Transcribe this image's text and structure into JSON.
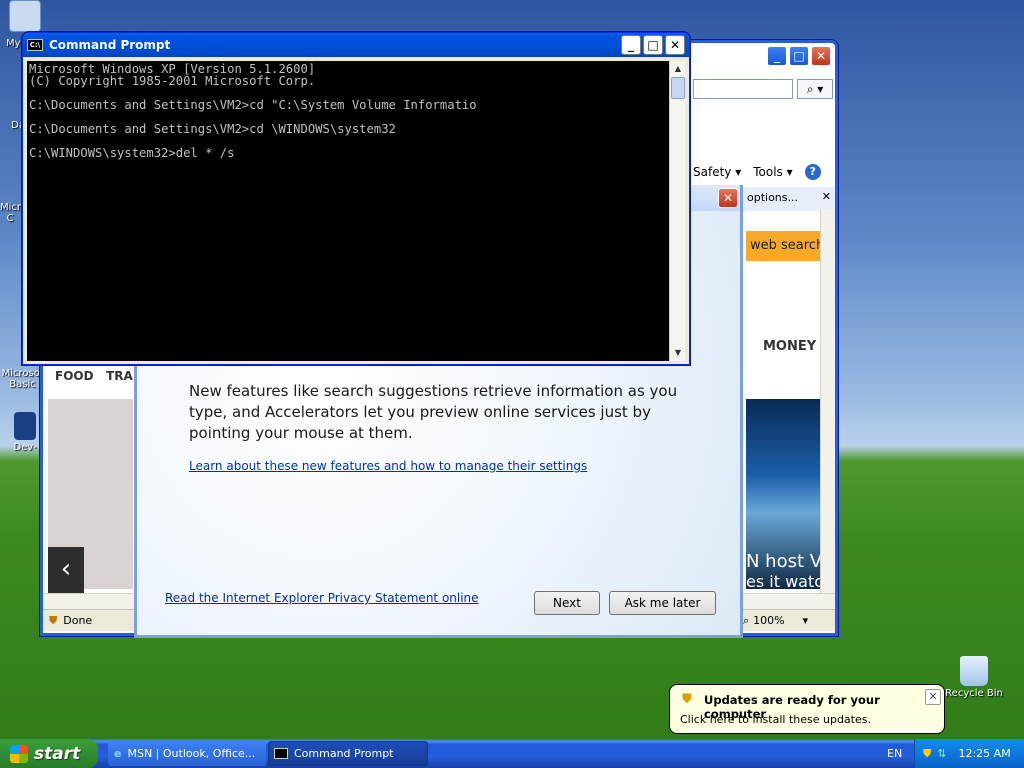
{
  "desktop": {
    "icons": [
      {
        "label": "My"
      },
      {
        "label": "Dat"
      },
      {
        "label": "Micro C"
      },
      {
        "label": "Microsof Basic"
      },
      {
        "label": "Dev-"
      },
      {
        "label": "Recycle Bin"
      }
    ]
  },
  "ie": {
    "search_icon": "magnifier-icon",
    "cmd_safety": "Safety ▾",
    "cmd_tools": "Tools ▾",
    "tab_options": "options...",
    "web_search": "web search",
    "money": "MONEY",
    "food": "FOOD",
    "tra": "TRA",
    "photo_text": "N host V",
    "photo_text2": "es it watc",
    "status": "Done",
    "zoom": "100%"
  },
  "setup": {
    "paragraph": "New features like search suggestions retrieve information as you type, and Accelerators let you preview online services just by pointing your mouse at them.",
    "learn_link": "Learn about these new features and how to manage their settings",
    "privacy_link": "Read the Internet Explorer Privacy Statement online",
    "next": "Next",
    "ask_later": "Ask me later"
  },
  "cmd": {
    "title": "Command Prompt",
    "lines": "Microsoft Windows XP [Version 5.1.2600]\n(C) Copyright 1985-2001 Microsoft Corp.\n\nC:\\Documents and Settings\\VM2>cd \"C:\\System Volume Informatio\n\nC:\\Documents and Settings\\VM2>cd \\WINDOWS\\system32\n\nC:\\WINDOWS\\system32>del * /s"
  },
  "taskbar": {
    "start": "start",
    "tasks": [
      "MSN | Outlook, Office...",
      "Command Prompt"
    ],
    "lang": "EN",
    "clock": "12:25 AM"
  },
  "balloon": {
    "title": "Updates are ready for your computer",
    "message": "Click here to install these updates."
  }
}
